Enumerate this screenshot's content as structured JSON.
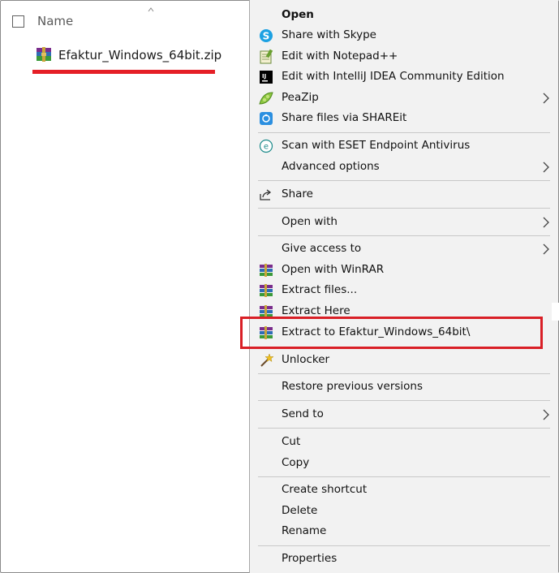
{
  "explorer": {
    "column_header": "Name",
    "file": {
      "name": "Efaktur_Windows_64bit.zip",
      "icon": "winrar-zip-icon"
    }
  },
  "menu": {
    "items": [
      {
        "label": "Open",
        "bold": true,
        "icon": "none"
      },
      {
        "label": "Share with Skype",
        "icon": "skype-icon"
      },
      {
        "label": "Edit with Notepad++",
        "icon": "notepadpp-icon"
      },
      {
        "label": "Edit with IntelliJ IDEA Community Edition",
        "icon": "intellij-icon"
      },
      {
        "label": "PeaZip",
        "icon": "peazip-icon",
        "submenu": true
      },
      {
        "label": "Share files via SHAREit",
        "icon": "shareit-icon"
      },
      {
        "label": "Scan with ESET Endpoint Antivirus",
        "icon": "eset-icon"
      },
      {
        "label": "Advanced options",
        "icon": "none",
        "submenu": true
      },
      {
        "label": "Share",
        "icon": "share-icon"
      },
      {
        "label": "Open with",
        "icon": "none",
        "submenu": true
      },
      {
        "label": "Give access to",
        "icon": "none",
        "submenu": true
      },
      {
        "label": "Open with WinRAR",
        "icon": "winrar-icon"
      },
      {
        "label": "Extract files...",
        "icon": "winrar-icon"
      },
      {
        "label": "Extract Here",
        "icon": "winrar-icon"
      },
      {
        "label": "Extract to Efaktur_Windows_64bit\\",
        "icon": "winrar-icon"
      },
      {
        "label": "Unlocker",
        "icon": "unlocker-wand-icon"
      },
      {
        "label": "Restore previous versions",
        "icon": "none"
      },
      {
        "label": "Send to",
        "icon": "none",
        "submenu": true
      },
      {
        "label": "Cut",
        "icon": "none"
      },
      {
        "label": "Copy",
        "icon": "none"
      },
      {
        "label": "Create shortcut",
        "icon": "none"
      },
      {
        "label": "Delete",
        "icon": "none"
      },
      {
        "label": "Rename",
        "icon": "none"
      },
      {
        "label": "Properties",
        "icon": "none"
      }
    ]
  },
  "annotation": {
    "highlight_color": "#d91f26",
    "underline_color": "#e51f26"
  }
}
